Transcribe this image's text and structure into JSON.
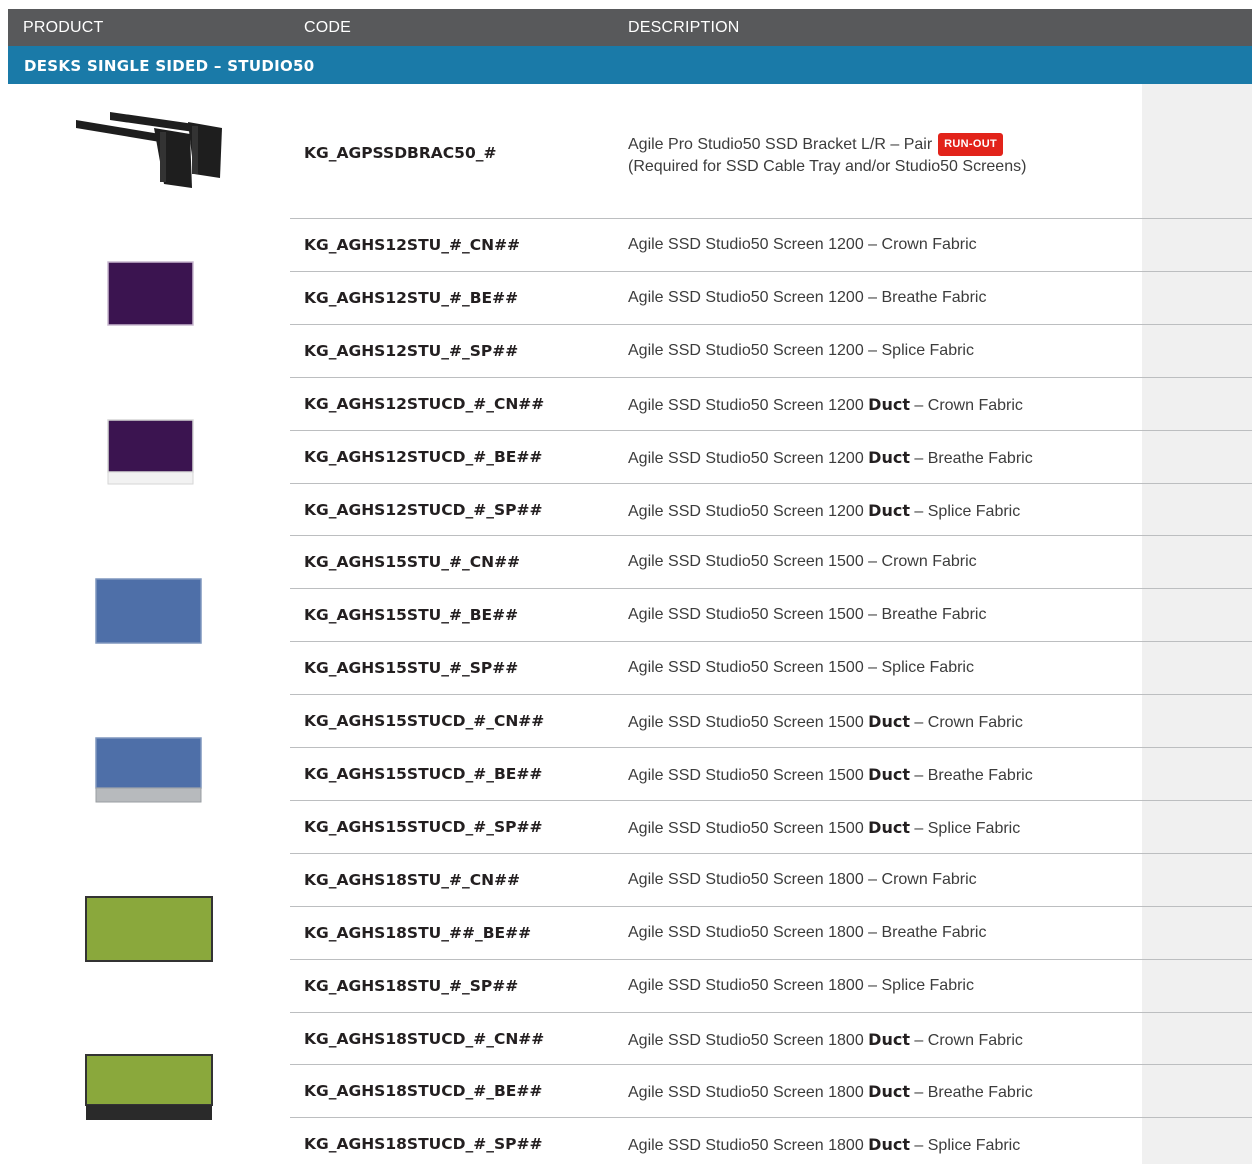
{
  "header": {
    "product_label": "PRODUCT",
    "code_label": "CODE",
    "description_label": "DESCRIPTION"
  },
  "section": {
    "title": "DESKS SINGLE SIDED – STUDIO50"
  },
  "colors": {
    "header_bg": "#58595b",
    "section_bg": "#1a7aa8",
    "badge_bg": "#e2231a",
    "screen_purple": "#3b1450",
    "screen_blue": "#4e6fa8",
    "screen_green": "#8aa83c"
  },
  "first_item": {
    "code": "KG_AGPSSDBRAC50_#",
    "desc_line1": "Agile Pro Studio50 SSD Bracket L/R – Pair",
    "badge": "RUN-OUT",
    "desc_line2": "(Required for SSD Cable Tray and/or Studio50 Screens)",
    "image": "bracket-image"
  },
  "rows": [
    {
      "code": "KG_AGHS12STU_#_CN##",
      "desc_pre": "Agile SSD Studio50 Screen 1200",
      "duct": "",
      "desc_post": " – Crown Fabric"
    },
    {
      "code": "KG_AGHS12STU_#_BE##",
      "desc_pre": "Agile SSD Studio50 Screen 1200",
      "duct": "",
      "desc_post": " – Breathe Fabric"
    },
    {
      "code": "KG_AGHS12STU_#_SP##",
      "desc_pre": "Agile SSD Studio50 Screen 1200",
      "duct": "",
      "desc_post": " – Splice Fabric"
    },
    {
      "code": "KG_AGHS12STUCD_#_CN##",
      "desc_pre": "Agile SSD Studio50 Screen 1200 ",
      "duct": "Duct",
      "desc_post": " – Crown Fabric"
    },
    {
      "code": "KG_AGHS12STUCD_#_BE##",
      "desc_pre": "Agile SSD Studio50 Screen 1200 ",
      "duct": "Duct",
      "desc_post": " – Breathe Fabric"
    },
    {
      "code": "KG_AGHS12STUCD_#_SP##",
      "desc_pre": "Agile SSD Studio50 Screen 1200 ",
      "duct": "Duct",
      "desc_post": " – Splice Fabric"
    },
    {
      "code": "KG_AGHS15STU_#_CN##",
      "desc_pre": "Agile SSD Studio50 Screen 1500",
      "duct": "",
      "desc_post": " – Crown Fabric"
    },
    {
      "code": "KG_AGHS15STU_#_BE##",
      "desc_pre": "Agile SSD Studio50 Screen 1500",
      "duct": "",
      "desc_post": " – Breathe Fabric"
    },
    {
      "code": "KG_AGHS15STU_#_SP##",
      "desc_pre": "Agile SSD Studio50 Screen 1500",
      "duct": "",
      "desc_post": " – Splice Fabric"
    },
    {
      "code": "KG_AGHS15STUCD_#_CN##",
      "desc_pre": "Agile SSD Studio50 Screen 1500 ",
      "duct": "Duct",
      "desc_post": " – Crown Fabric"
    },
    {
      "code": "KG_AGHS15STUCD_#_BE##",
      "desc_pre": "Agile SSD Studio50 Screen 1500 ",
      "duct": "Duct",
      "desc_post": " – Breathe Fabric"
    },
    {
      "code": "KG_AGHS15STUCD_#_SP##",
      "desc_pre": "Agile SSD Studio50 Screen 1500 ",
      "duct": "Duct",
      "desc_post": " – Splice Fabric"
    },
    {
      "code": "KG_AGHS18STU_#_CN##",
      "desc_pre": "Agile SSD Studio50 Screen 1800",
      "duct": "",
      "desc_post": " – Crown Fabric"
    },
    {
      "code": "KG_AGHS18STU_##_BE##",
      "desc_pre": "Agile SSD Studio50 Screen 1800",
      "duct": "",
      "desc_post": " – Breathe Fabric"
    },
    {
      "code": "KG_AGHS18STU_#_SP##",
      "desc_pre": "Agile SSD Studio50 Screen 1800",
      "duct": "",
      "desc_post": " – Splice Fabric"
    },
    {
      "code": "KG_AGHS18STUCD_#_CN##",
      "desc_pre": "Agile SSD Studio50 Screen 1800 ",
      "duct": "Duct",
      "desc_post": " – Crown Fabric"
    },
    {
      "code": "KG_AGHS18STUCD_#_BE##",
      "desc_pre": "Agile SSD Studio50 Screen 1800 ",
      "duct": "Duct",
      "desc_post": " – Breathe Fabric"
    },
    {
      "code": "KG_AGHS18STUCD_#_SP##",
      "desc_pre": "Agile SSD Studio50 Screen 1800 ",
      "duct": "Duct",
      "desc_post": " – Splice Fabric"
    }
  ]
}
